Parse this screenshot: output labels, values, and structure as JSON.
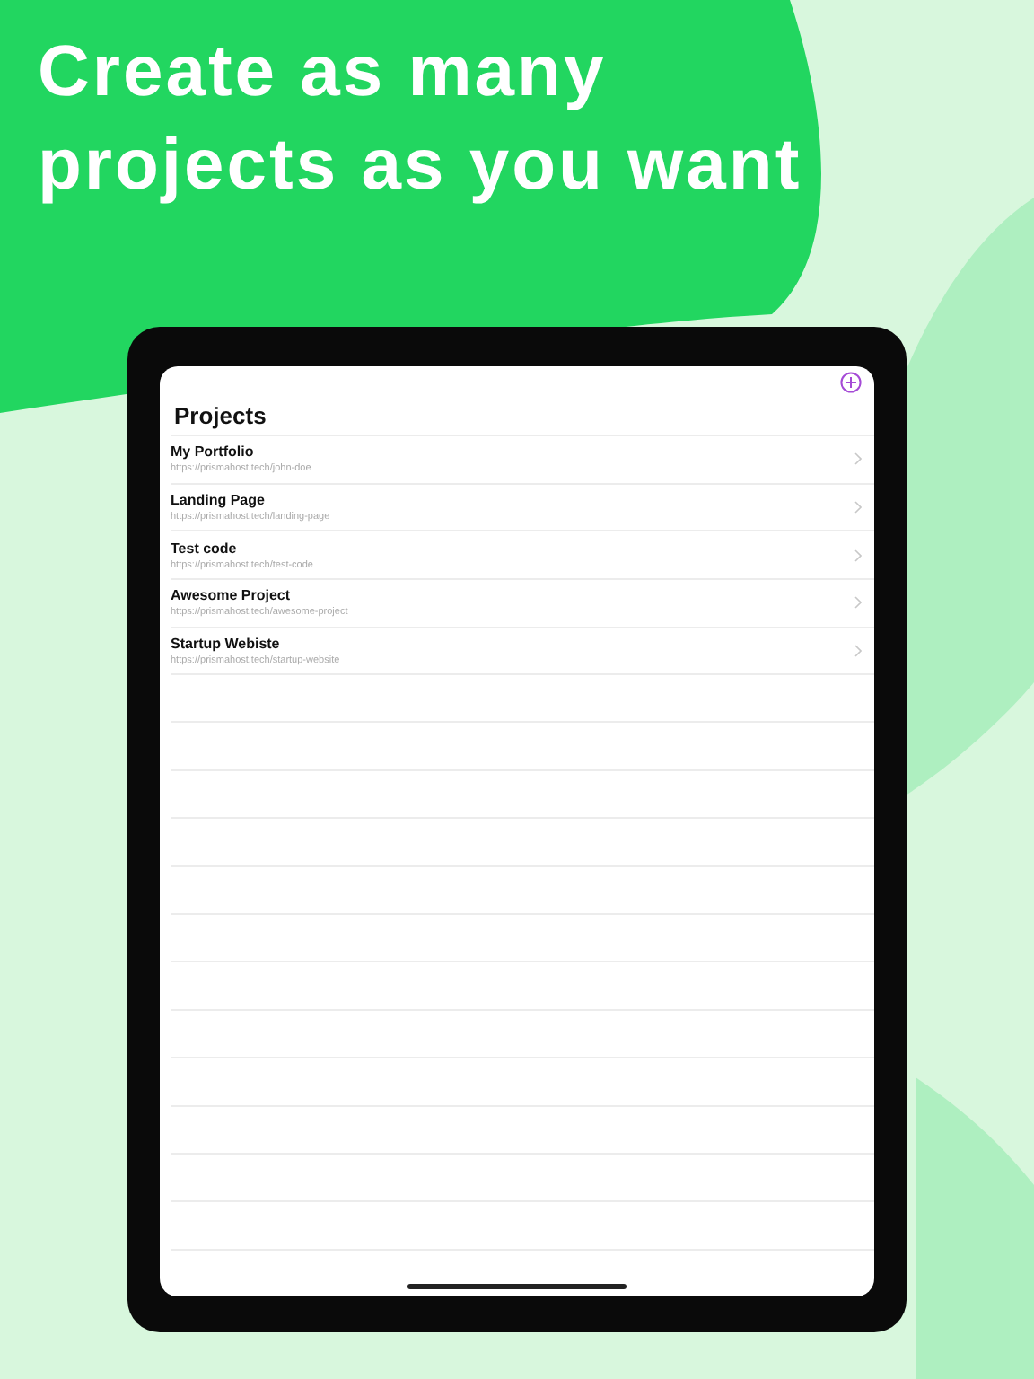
{
  "headline": "Create as many projects as you want",
  "screen": {
    "title": "Projects",
    "projects": [
      {
        "name": "My Portfolio",
        "url": "https://prismahost.tech/john-doe"
      },
      {
        "name": "Landing Page",
        "url": "https://prismahost.tech/landing-page"
      },
      {
        "name": "Test code",
        "url": "https://prismahost.tech/test-code"
      },
      {
        "name": "Awesome Project",
        "url": "https://prismahost.tech/awesome-project"
      },
      {
        "name": "Startup Webiste",
        "url": "https://prismahost.tech/startup-website"
      }
    ]
  }
}
